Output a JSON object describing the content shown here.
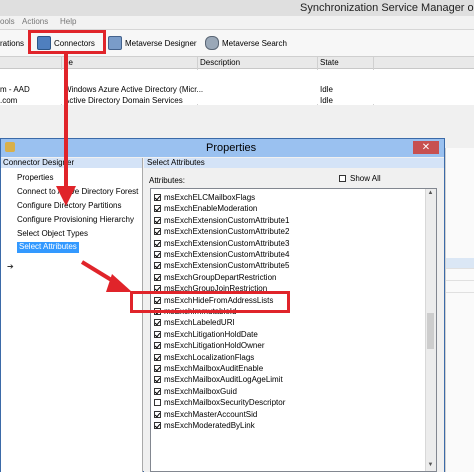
{
  "main_window": {
    "title": "Synchronization Service Manager on",
    "menu": [
      "ools",
      "Actions",
      "Help"
    ],
    "toolbar": {
      "operations": "rations",
      "connectors": "Connectors",
      "metaverse_designer": "Metaverse Designer",
      "metaverse_search": "Metaverse Search"
    },
    "columns": [
      "pe",
      "Description",
      "State"
    ],
    "rows": [
      {
        "name": "m - AAD",
        "type": "Windows Azure Active Directory (Micr...",
        "state": "Idle"
      },
      {
        "name": ".com",
        "type": "Active Directory Domain Services",
        "state": "Idle"
      }
    ]
  },
  "dialog": {
    "title": "Properties",
    "close": "✕",
    "left_header": "Connector Designer",
    "nav": [
      "Properties",
      "Connect to Active Directory Forest",
      "Configure Directory Partitions",
      "Configure Provisioning Hierarchy",
      "Select Object Types",
      "Select Attributes"
    ],
    "nav_arrow": "➔",
    "right_header": "Select Attributes",
    "attributes_label": "Attributes:",
    "show_all": "Show All",
    "attributes": [
      {
        "name": "msExchELCMailboxFlags",
        "checked": true
      },
      {
        "name": "msExchEnableModeration",
        "checked": true
      },
      {
        "name": "msExchExtensionCustomAttribute1",
        "checked": true
      },
      {
        "name": "msExchExtensionCustomAttribute2",
        "checked": true
      },
      {
        "name": "msExchExtensionCustomAttribute3",
        "checked": true
      },
      {
        "name": "msExchExtensionCustomAttribute4",
        "checked": true
      },
      {
        "name": "msExchExtensionCustomAttribute5",
        "checked": true
      },
      {
        "name": "msExchGroupDepartRestriction",
        "checked": true
      },
      {
        "name": "msExchGroupJoinRestriction",
        "checked": true
      },
      {
        "name": "msExchHideFromAddressLists",
        "checked": true
      },
      {
        "name": "msExchImmutableId",
        "checked": true
      },
      {
        "name": "msExchLabeledURI",
        "checked": true
      },
      {
        "name": "msExchLitigationHoldDate",
        "checked": true
      },
      {
        "name": "msExchLitigationHoldOwner",
        "checked": true
      },
      {
        "name": "msExchLocalizationFlags",
        "checked": true
      },
      {
        "name": "msExchMailboxAuditEnable",
        "checked": true
      },
      {
        "name": "msExchMailboxAuditLogAgeLimit",
        "checked": true
      },
      {
        "name": "msExchMailboxGuid",
        "checked": true
      },
      {
        "name": "msExchMailboxSecurityDescriptor",
        "checked": false
      },
      {
        "name": "msExchMasterAccountSid",
        "checked": true
      },
      {
        "name": "msExchModeratedByLink",
        "checked": true
      }
    ]
  },
  "colors": {
    "highlight": "#e0242a",
    "dialog_title": "#9ac1f0",
    "selection": "#3399ff"
  }
}
